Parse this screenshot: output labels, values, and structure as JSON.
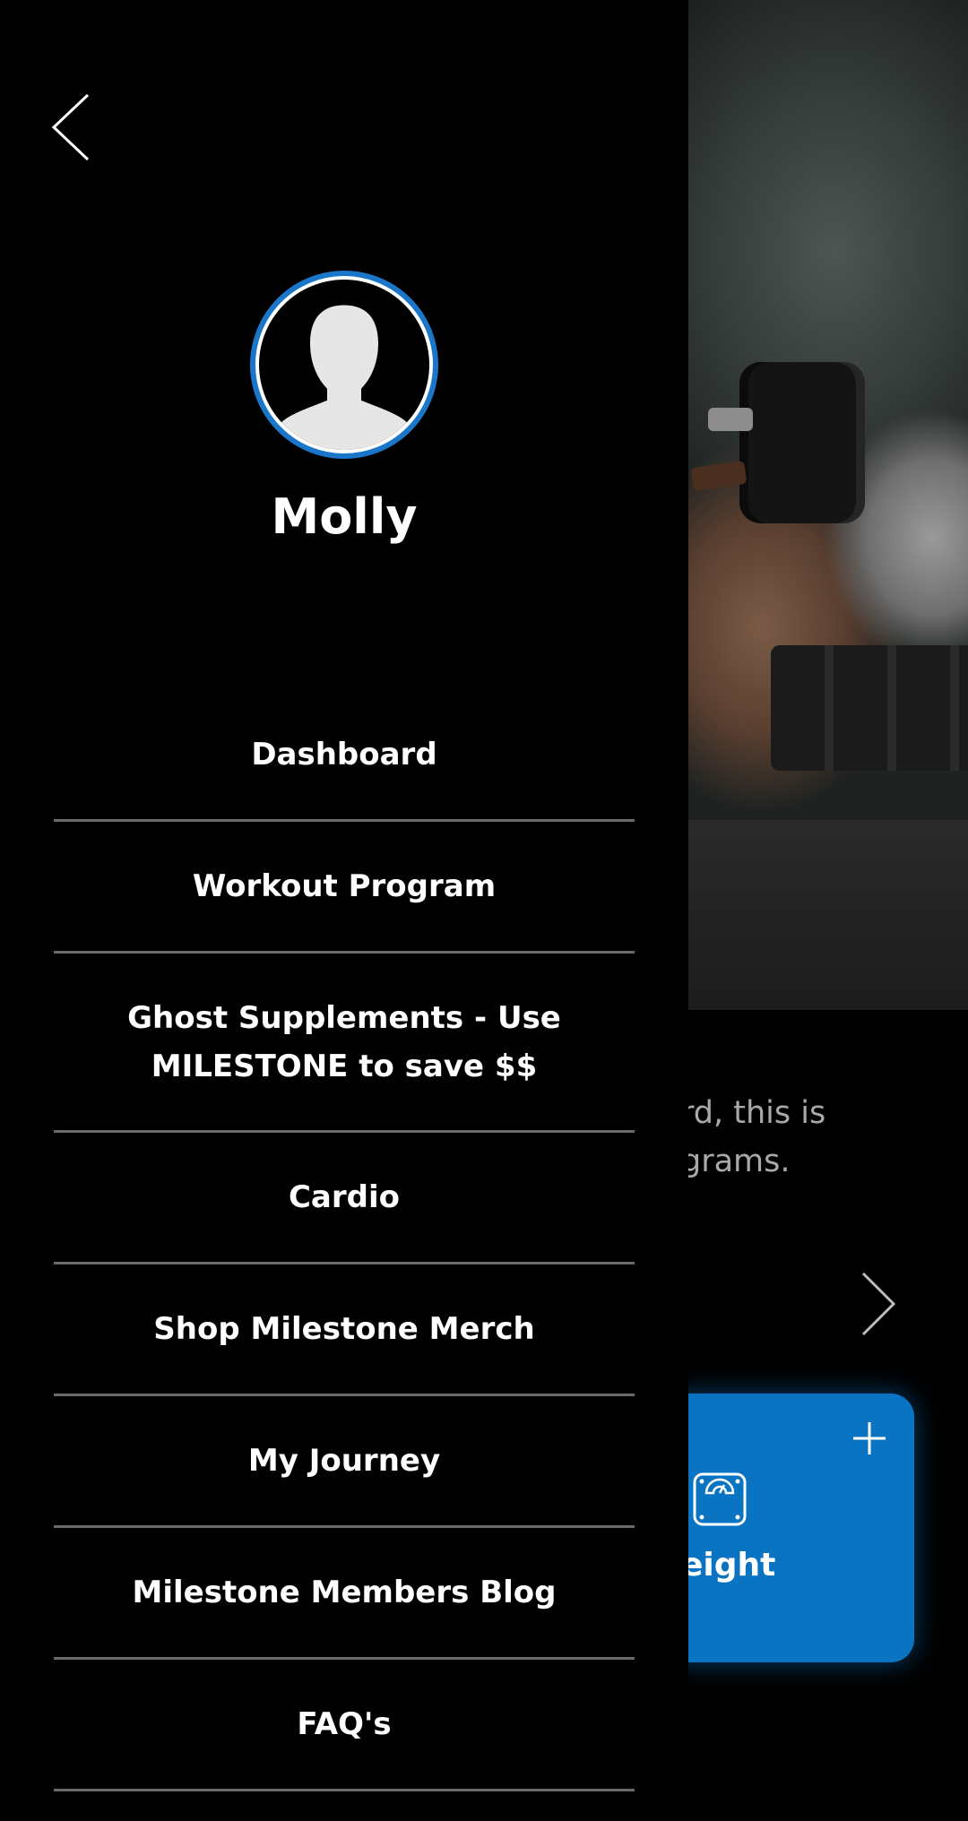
{
  "drawer": {
    "back_icon": "chevron-left-icon",
    "avatar_icon": "user-silhouette-icon",
    "user_name": "Molly",
    "menu": [
      {
        "label": "Dashboard"
      },
      {
        "label": "Workout Program"
      },
      {
        "label": "Ghost Supplements - Use\nMILESTONE to save $$"
      },
      {
        "label": "Cardio"
      },
      {
        "label": "Shop Milestone Merch"
      },
      {
        "label": "My Journey"
      },
      {
        "label": "Milestone Members Blog"
      },
      {
        "label": "FAQ's"
      }
    ]
  },
  "background": {
    "intro_text": "rd, this is\ngrams.",
    "next_icon": "chevron-right-icon",
    "weight_card": {
      "label": "eight",
      "icon": "scale-icon",
      "add_icon": "plus-icon",
      "color": "#0a74c2"
    }
  },
  "colors": {
    "accent": "#1976c9",
    "drawer_bg": "#000000",
    "divider": "#6b6b6b"
  }
}
